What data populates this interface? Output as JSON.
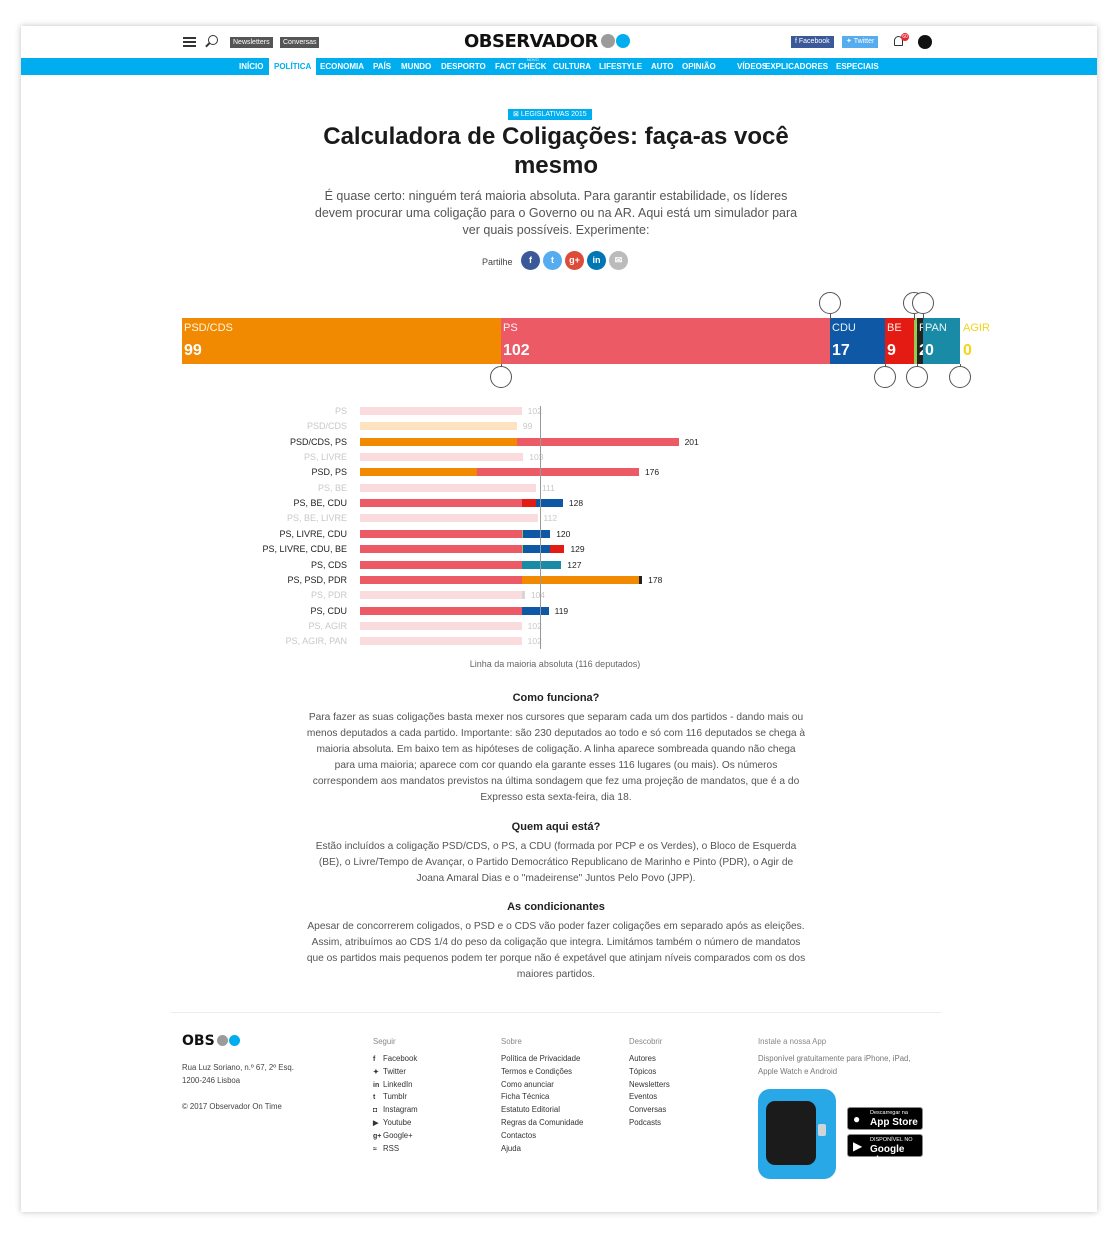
{
  "header": {
    "logo": "OBSERVADOR",
    "pills": [
      "Newsletters",
      "Conversas"
    ],
    "social": [
      "Facebook",
      "Twitter"
    ],
    "notifications": "60"
  },
  "nav": {
    "items": [
      "INÍCIO",
      "POLÍTICA",
      "ECONOMIA",
      "PAÍS",
      "MUNDO",
      "DESPORTO",
      "FACT CHECK",
      "CULTURA",
      "LIFESTYLE",
      "AUTO",
      "OPINIÃO",
      "VÍDEOS",
      "EXPLICADORES",
      "ESPECIAIS"
    ],
    "active": "POLÍTICA",
    "nova_badge": "NOVO"
  },
  "article": {
    "tag": "LEGISLATIVAS 2015",
    "title": "Calculadora de Coligações: faça-as você mesmo",
    "lead": "É quase certo: ninguém terá maioria absoluta. Para garantir estabilidade, os líderes devem procurar uma coligação para o Governo ou na AR. Aqui está um simulador para ver quais possíveis. Experimente:",
    "share_label": "Partilhe",
    "share_icons": [
      "facebook-icon",
      "twitter-icon",
      "google-plus-icon",
      "linkedin-icon",
      "email-icon"
    ]
  },
  "parties": [
    {
      "name": "PSD/CDS",
      "seats": "99",
      "color": "#f18a00"
    },
    {
      "name": "PS",
      "seats": "102",
      "color": "#ec5a66"
    },
    {
      "name": "CDU",
      "seats": "17",
      "color": "#0e58a5"
    },
    {
      "name": "BE",
      "seats": "9",
      "color": "#e41b12"
    },
    {
      "name": "LIVRE",
      "seats": "1",
      "color": "#94c952"
    },
    {
      "name": "PDR",
      "seats": "2",
      "color": "#222222"
    },
    {
      "name": "PAN",
      "seats": "0",
      "color": "#1a8ba6"
    },
    {
      "name": "AGIR",
      "seats": "0",
      "color": "#f5d417"
    }
  ],
  "coalitions": [
    {
      "label": "PS",
      "total": "102",
      "majority": false
    },
    {
      "label": "PSD/CDS",
      "total": "99",
      "majority": false
    },
    {
      "label": "PSD/CDS, PS",
      "total": "201",
      "majority": true
    },
    {
      "label": "PS, LIVRE",
      "total": "103",
      "majority": false
    },
    {
      "label": "PSD, PS",
      "total": "176",
      "majority": true
    },
    {
      "label": "PS, BE",
      "total": "111",
      "majority": false
    },
    {
      "label": "PS, BE, CDU",
      "total": "128",
      "majority": true
    },
    {
      "label": "PS, BE, LIVRE",
      "total": "112",
      "majority": false
    },
    {
      "label": "PS, LIVRE, CDU",
      "total": "120",
      "majority": true
    },
    {
      "label": "PS, LIVRE, CDU, BE",
      "total": "129",
      "majority": true
    },
    {
      "label": "PS, CDS",
      "total": "127",
      "majority": true
    },
    {
      "label": "PS, PSD, PDR",
      "total": "178",
      "majority": true
    },
    {
      "label": "PS, PDR",
      "total": "104",
      "majority": false
    },
    {
      "label": "PS, CDU",
      "total": "119",
      "majority": true
    },
    {
      "label": "PS, AGIR",
      "total": "102",
      "majority": false
    },
    {
      "label": "PS, AGIR, PAN",
      "total": "102",
      "majority": false
    }
  ],
  "majority_line": "Linha da maioria absoluta (116 deputados)",
  "sections": [
    {
      "title": "Como funciona?",
      "text": "Para fazer as suas coligações basta mexer nos cursores que separam cada um dos partidos - dando mais ou menos deputados a cada partido. Importante: são 230 deputados ao todo e só com 116 deputados se chega à maioria absoluta. Em baixo tem as hipóteses de coligação. A linha aparece sombreada quando não chega para uma maioria; aparece com cor quando ela garante esses 116 lugares (ou mais). Os números correspondem aos mandatos previstos na última sondagem que fez uma projeção de mandatos, que é a do Expresso esta sexta-feira, dia 18."
    },
    {
      "title": "Quem aqui está?",
      "text": "Estão incluídos a coligação PSD/CDS, o PS, a CDU (formada por PCP e os Verdes), o Bloco de Esquerda (BE), o Livre/Tempo de Avançar, o Partido Democrático Republicano de Marinho e Pinto (PDR), o Agir de Joana Amaral Dias e o \"madeirense\" Juntos Pelo Povo (JPP)."
    },
    {
      "title": "As condicionantes",
      "text": "Apesar de concorrerem coligados, o PSD e o CDS vão poder fazer coligações em separado após as eleições. Assim, atribuímos ao CDS 1/4 do peso da coligação que integra. Limitámos também o número de mandatos que os partidos mais pequenos podem ter porque não é expetável que atinjam níveis comparados com os dos maiores partidos."
    }
  ],
  "footer": {
    "logo": "OBS",
    "address": [
      "Rua Luz Soriano, n.º 67, 2º Esq.",
      "1200-246 Lisboa"
    ],
    "copyright": "© 2017 Observador On Time",
    "seguir": {
      "title": "Seguir",
      "links": [
        "Facebook",
        "Twitter",
        "LinkedIn",
        "Tumblr",
        "Instagram",
        "Youtube",
        "Google+",
        "RSS"
      ]
    },
    "sobre": {
      "title": "Sobre",
      "links": [
        "Política de Privacidade",
        "Termos e Condições",
        "Como anunciar",
        "Ficha Técnica",
        "Estatuto Editorial",
        "Regras da Comunidade",
        "Contactos",
        "Ajuda"
      ]
    },
    "descobrir": {
      "title": "Descobrir",
      "links": [
        "Autores",
        "Tópicos",
        "Newsletters",
        "Eventos",
        "Conversas",
        "Podcasts"
      ]
    },
    "app": {
      "title": "Instale a nossa App",
      "text": [
        "Disponível gratuitamente para iPhone, iPad,",
        "Apple Watch e Android"
      ],
      "appstore_small": "Descarregar na",
      "appstore_big": "App Store",
      "google_small": "DISPONÍVEL NO",
      "google_big": "Google play"
    }
  },
  "colors": {
    "brand": "#00aeef",
    "gray_dot": "#9b9b9b"
  }
}
